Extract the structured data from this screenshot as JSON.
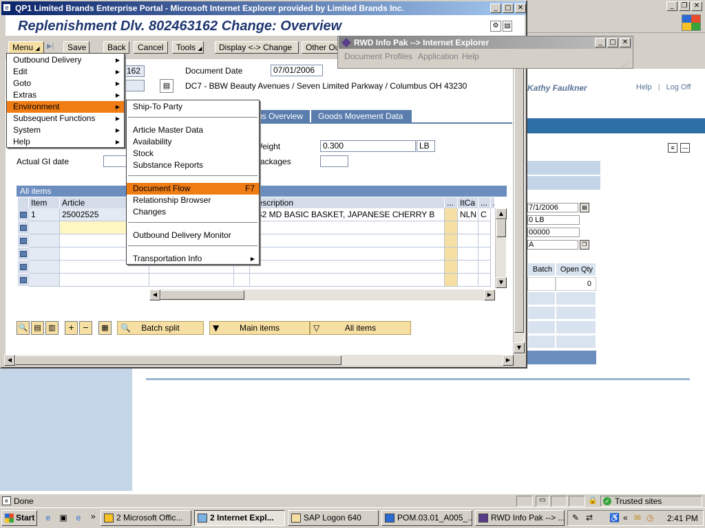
{
  "bg_browser": {
    "user_name": "Kathy Faulkner",
    "help_link": "Help",
    "logoff_link": "Log Off",
    "panel_fields": [
      "7/1/2006",
      "0 LB",
      "00000",
      "A"
    ],
    "grid_headers": [
      "Batch",
      "Open Qty"
    ],
    "grid_value": "0"
  },
  "sap": {
    "window_title": "QP1 Limited Brands Enterprise Portal - Microsoft Internet Explorer provided by Limited Brands Inc.",
    "screen_title": "Replenishment Dlv. 802463162 Change: Overview",
    "toolbar": {
      "menu": "Menu",
      "save": "Save",
      "back": "Back",
      "cancel": "Cancel",
      "tools": "Tools",
      "display_change": "Display <-> Change",
      "other": "Other Ou"
    },
    "header": {
      "delivery_partial": "162",
      "document_date_label": "Document Date",
      "document_date": "07/01/2006",
      "ship_to_address": "DC7 - BBW Beauty Avenues / Seven Limited Parkway / Columbus OH 43230"
    },
    "tabs": [
      "us Overview",
      "Goods Movement Data"
    ],
    "fields": {
      "weight_label": "Weight",
      "weight_value": "0.300",
      "weight_unit": "LB",
      "packages_label": "Packages",
      "actual_gi_label": "Actual GI date"
    },
    "items": {
      "title": "All items",
      "columns": [
        "Item",
        "Article",
        "Description",
        "...",
        "ItCa",
        "...",
        "."
      ],
      "rows": [
        {
          "item": "1",
          "article": "25002525",
          "description": "_S2 MD BASIC BASKET, JAPANESE CHERRY B",
          "itca": "NLN",
          "extra": "C"
        }
      ]
    },
    "bottom_buttons": {
      "batch_split": "Batch split",
      "main_items": "Main items",
      "all_items": "All items"
    }
  },
  "menu": {
    "items": [
      "Outbound Delivery",
      "Edit",
      "Goto",
      "Extras",
      "Environment",
      "Subsequent Functions",
      "System",
      "Help"
    ],
    "highlighted": "Environment"
  },
  "submenu": {
    "ship_to_party": "Ship-To Party",
    "article_master": "Article Master Data",
    "availability": "Availability",
    "stock": "Stock",
    "substance_reports": "Substance Reports",
    "document_flow": "Document Flow",
    "document_flow_shortcut": "F7",
    "relationship_browser": "Relationship Browser",
    "changes": "Changes",
    "outbound_monitor": "Outbound Delivery Monitor",
    "transportation_info": "Transportation Info"
  },
  "rwd": {
    "title": "RWD Info Pak --> Internet Explorer",
    "menus": [
      "Document",
      "Profiles",
      "Application",
      "Help"
    ]
  },
  "status": {
    "text": "Done",
    "zone": "Trusted sites"
  },
  "taskbar": {
    "start": "Start",
    "buttons": [
      "2 Microsoft Offic...",
      "2 Internet Expl...",
      "SAP Logon 640",
      "POM.03.01_A005_...",
      "RWD Info Pak --> ..."
    ],
    "clock": "2:41 PM"
  },
  "colors": {
    "menu_highlight": "#f07c14",
    "sap_tab": "#5a7dae",
    "title_gradient_start": "#0a246a"
  }
}
